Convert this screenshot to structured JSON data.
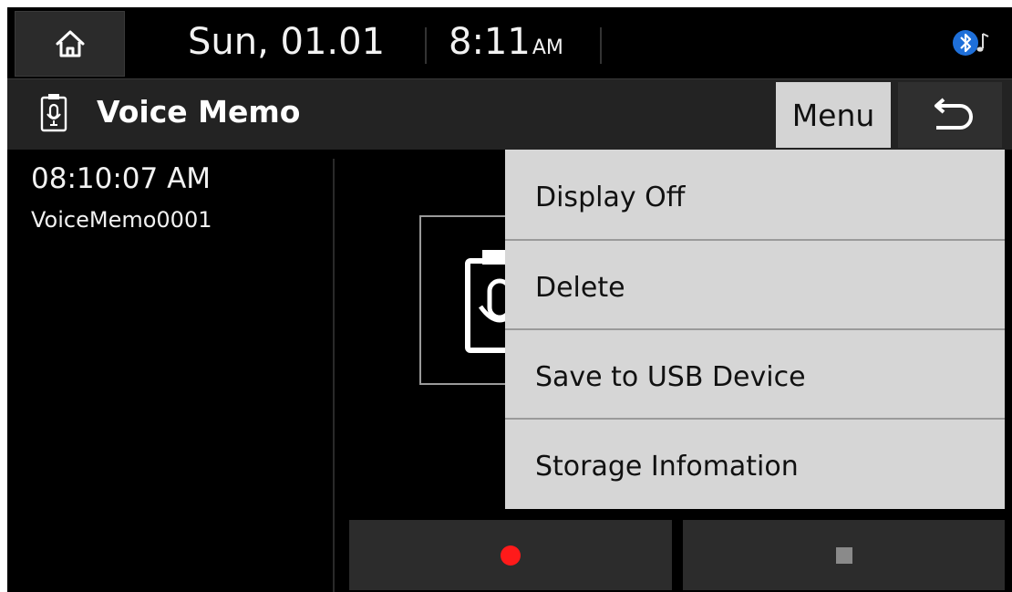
{
  "status": {
    "date": "Sun, 01.01",
    "time": "8:11",
    "ampm": "AM"
  },
  "titlebar": {
    "title": "Voice Memo",
    "menu_label": "Menu"
  },
  "recording": {
    "time": "08:10:07 AM",
    "name": "VoiceMemo0001"
  },
  "menu": {
    "items": [
      {
        "label": "Display Off"
      },
      {
        "label": "Delete"
      },
      {
        "label": "Save to USB Device"
      },
      {
        "label": "Storage Infomation"
      }
    ]
  },
  "icons": {
    "home": "home-icon",
    "bluetooth": "bluetooth-audio-icon",
    "title": "voice-memo-icon",
    "back": "back-arrow-icon",
    "record": "record-icon",
    "stop": "stop-icon"
  },
  "colors": {
    "background": "#000000",
    "bar": "#232323",
    "menu_bg": "#d6d6d6",
    "record": "#ff1a1a",
    "bluetooth": "#1e6fd9"
  }
}
